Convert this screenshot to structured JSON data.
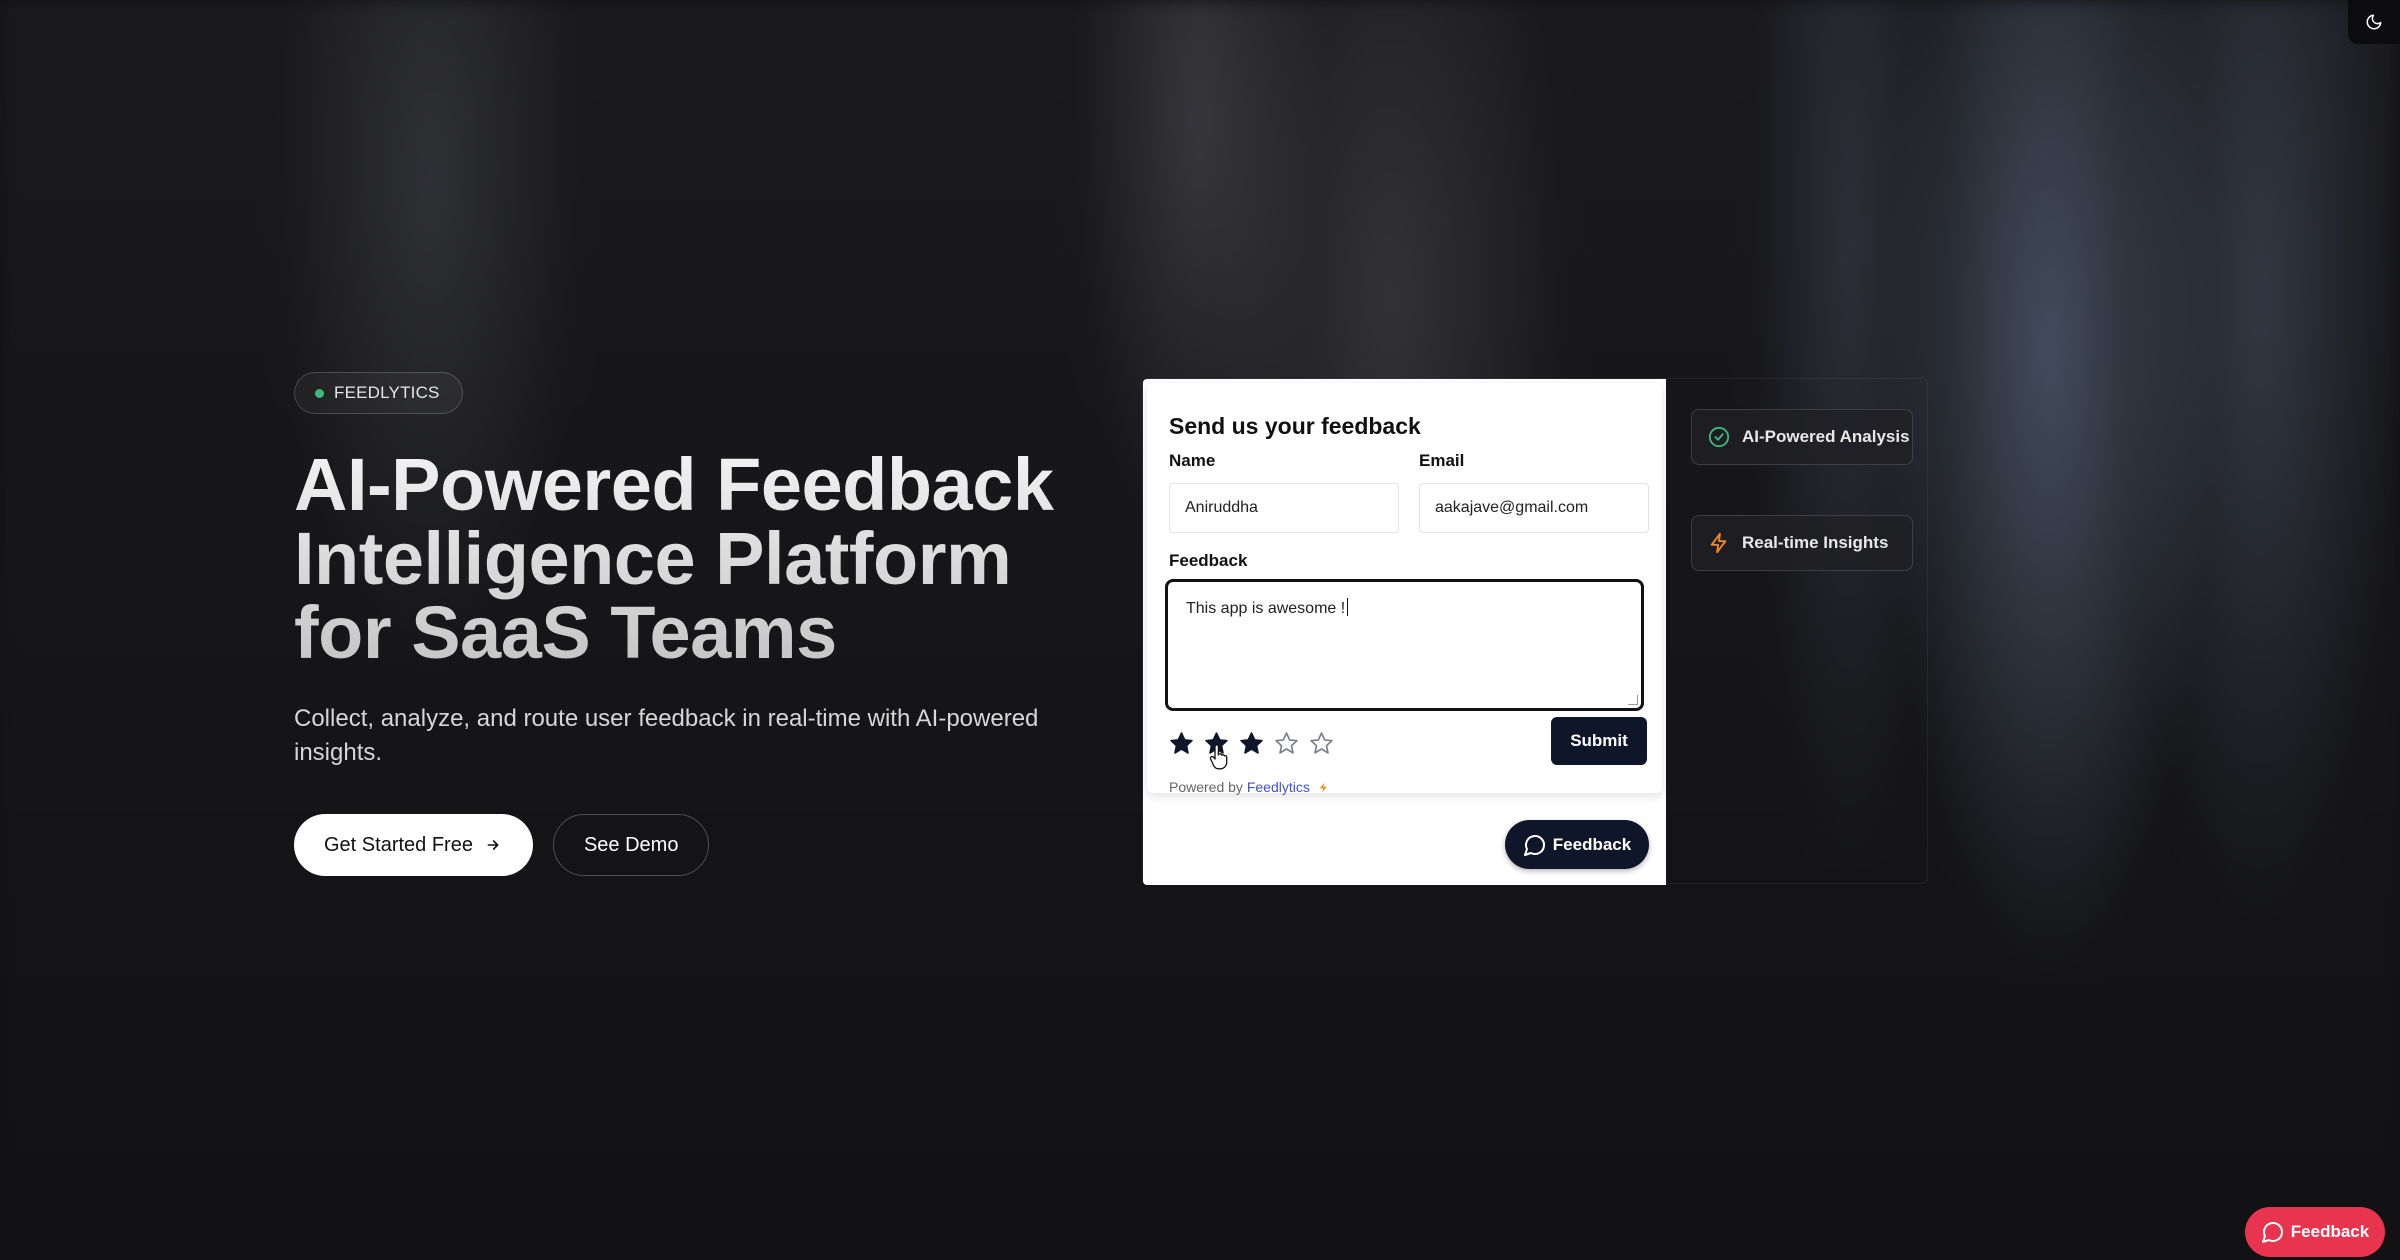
{
  "hero": {
    "badge": "FEEDLYTICS",
    "title_line1": "AI-Powered Feedback",
    "title_line2": "Intelligence Platform",
    "title_line3": "for SaaS Teams",
    "subtitle": "Collect, analyze, and route user feedback in real-time with AI-powered insights.",
    "primary_cta": "Get Started Free",
    "secondary_cta": "See Demo"
  },
  "form": {
    "title": "Send us your feedback",
    "name_label": "Name",
    "name_value": "Aniruddha",
    "email_label": "Email",
    "email_value": "aakajave@gmail.com",
    "feedback_label": "Feedback",
    "feedback_value": "This app is awesome !",
    "rating": 3,
    "rating_max": 5,
    "submit_label": "Submit",
    "powered_prefix": "Powered by",
    "powered_brand": "Feedlytics"
  },
  "widget_button": "Feedback",
  "features": [
    {
      "label": "AI-Powered Analysis",
      "icon": "check-circle-icon"
    },
    {
      "label": "Real-time Insights",
      "icon": "lightning-icon"
    }
  ],
  "floating_button": "Feedback",
  "colors": {
    "accent_green": "#3fb97a",
    "navy": "#0f1629",
    "feedback_red": "#e8344e",
    "bolt_orange": "#f08a2a",
    "link_blue": "#4452c9"
  }
}
